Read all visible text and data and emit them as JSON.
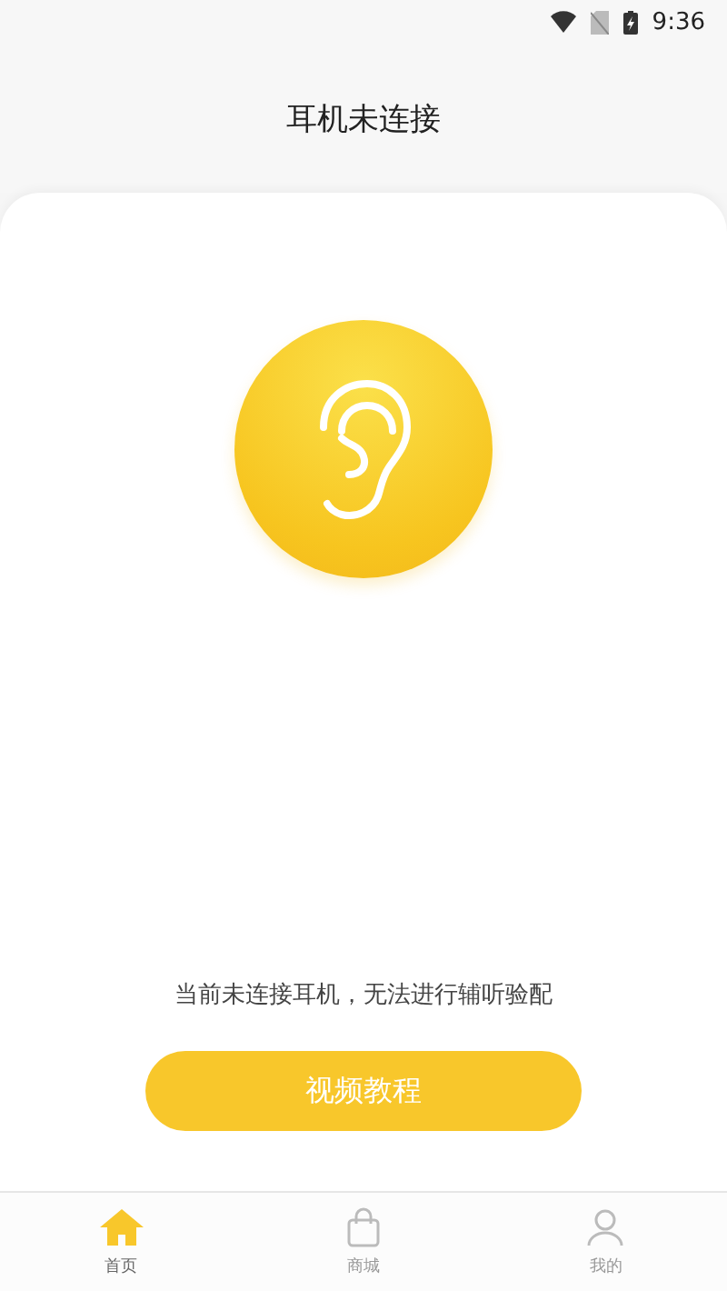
{
  "status_bar": {
    "time": "9:36"
  },
  "header": {
    "title": "耳机未连接"
  },
  "message": "当前未连接耳机，无法进行辅听验配",
  "action_button": {
    "label": "视频教程"
  },
  "tabs": [
    {
      "label": "首页",
      "kind": "home",
      "selected": true
    },
    {
      "label": "商城",
      "kind": "shop",
      "selected": false
    },
    {
      "label": "我的",
      "kind": "profile",
      "selected": false
    }
  ]
}
